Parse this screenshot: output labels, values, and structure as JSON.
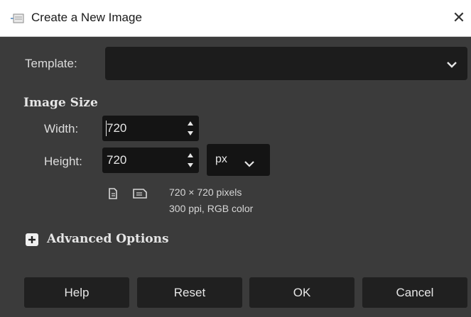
{
  "window": {
    "title": "Create a New Image",
    "title_icon": "gimp-new-image-icon",
    "close_glyph": "✕"
  },
  "template": {
    "label": "Template:",
    "value": ""
  },
  "image_size": {
    "heading": "Image Size",
    "width_label": "Width:",
    "width_value": "720",
    "height_label": "Height:",
    "height_value": "720",
    "unit": "px"
  },
  "info": {
    "line1": "720 × 720 pixels",
    "line2": "300 ppi, RGB color"
  },
  "advanced": {
    "label": "Advanced Options",
    "icon": "plus-icon"
  },
  "buttons": {
    "help": "Help",
    "reset": "Reset",
    "ok": "OK",
    "cancel": "Cancel"
  },
  "colors": {
    "background": "#3b3b3b",
    "field": "#1c1c1c",
    "button": "#202020",
    "text": "#dcdcdc"
  }
}
